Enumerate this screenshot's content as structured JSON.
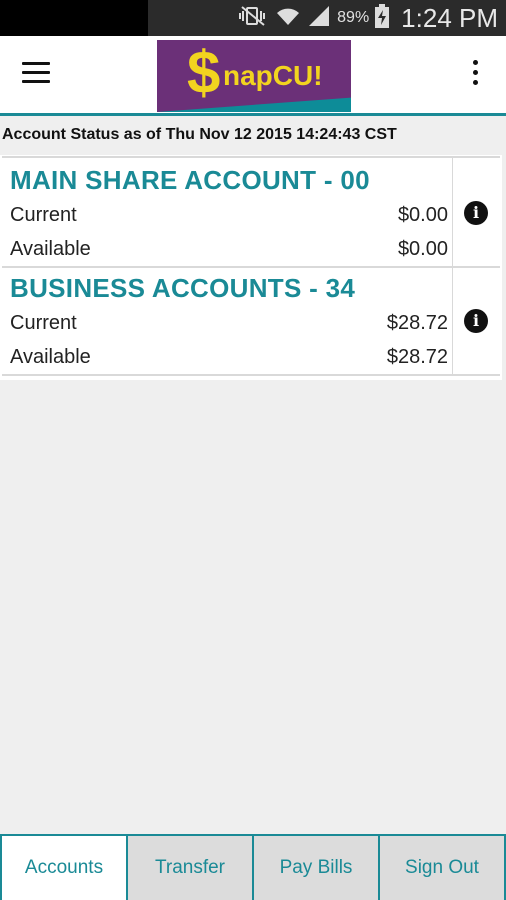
{
  "status_bar": {
    "battery_percent": "89%",
    "time": "1:24 PM",
    "icons": [
      "mute-vibrate-icon",
      "wifi-icon",
      "signal-icon",
      "battery-charging-icon"
    ]
  },
  "app_bar": {
    "logo": {
      "dollar": "$",
      "text": "napCU!"
    },
    "menu_icon": "hamburger-menu-icon",
    "overflow_icon": "overflow-menu-icon"
  },
  "status_line": "Account Status as of Thu Nov 12 2015 14:24:43 CST",
  "accounts": [
    {
      "title": "MAIN SHARE ACCOUNT - 00",
      "rows": [
        {
          "label": "Current",
          "value": "$0.00"
        },
        {
          "label": "Available",
          "value": "$0.00"
        }
      ]
    },
    {
      "title": "BUSINESS ACCOUNTS - 34",
      "rows": [
        {
          "label": "Current",
          "value": "$28.72"
        },
        {
          "label": "Available",
          "value": "$28.72"
        }
      ]
    }
  ],
  "tabs": [
    {
      "label": "Accounts",
      "active": true
    },
    {
      "label": "Transfer",
      "active": false
    },
    {
      "label": "Pay Bills",
      "active": false
    },
    {
      "label": "Sign Out",
      "active": false
    }
  ],
  "colors": {
    "accent": "#1a8a96",
    "logo_bg": "#6b3078",
    "logo_text": "#f2d41f"
  }
}
